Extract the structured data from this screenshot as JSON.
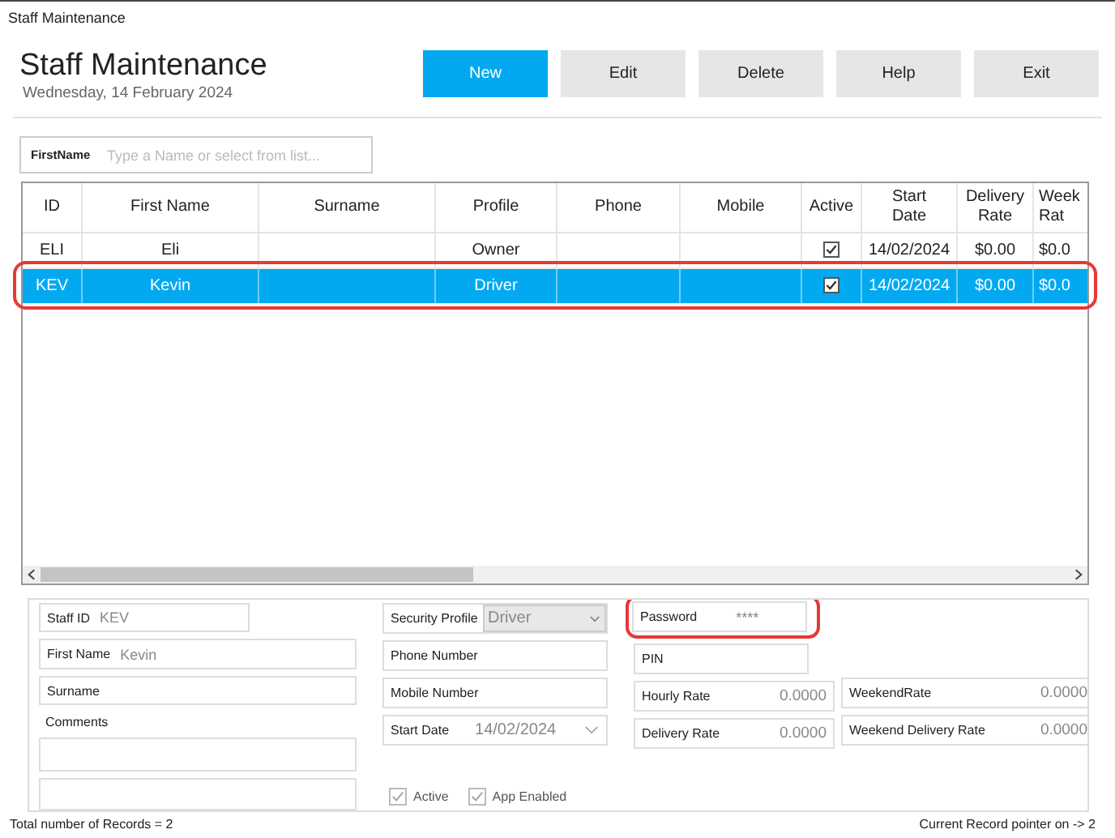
{
  "window": {
    "title": "Staff Maintenance"
  },
  "header": {
    "title": "Staff Maintenance",
    "date": "Wednesday, 14 February 2024"
  },
  "buttons": [
    {
      "label": "New",
      "primary": true
    },
    {
      "label": "Edit",
      "primary": false
    },
    {
      "label": "Delete",
      "primary": false
    },
    {
      "label": "Help",
      "primary": false
    },
    {
      "label": "Exit",
      "primary": false
    }
  ],
  "search": {
    "label": "FirstName",
    "placeholder": "Type a Name or select from list..."
  },
  "table": {
    "columns": [
      "ID",
      "First Name",
      "Surname",
      "Profile",
      "Phone",
      "Mobile",
      "Active",
      "Start Date",
      "Delivery Rate",
      "Week Rat"
    ],
    "rows": [
      {
        "id": "ELI",
        "first_name": "Eli",
        "profile": "Owner",
        "active": true,
        "start_date": "14/02/2024",
        "delivery_rate": "$0.00",
        "column_10": "$0.0",
        "selected": false,
        "highlighted": false
      },
      {
        "id": "KEV",
        "first_name": "Kevin",
        "profile": "Driver",
        "active": true,
        "start_date": "14/02/2024",
        "delivery_rate": "$0.00",
        "column_10": "$0.0",
        "selected": true,
        "highlighted": true
      }
    ]
  },
  "form": {
    "columns": [
      {
        "items": [
          {
            "kind": "text",
            "label": "Staff ID",
            "value": "KEV"
          },
          {
            "kind": "text",
            "label": "First Name",
            "value": "Kevin"
          },
          {
            "kind": "text",
            "label": "Surname"
          },
          {
            "kind": "caption",
            "label": "Comments"
          },
          {
            "kind": "memo"
          },
          {
            "kind": "memo"
          }
        ]
      },
      {
        "items": [
          {
            "kind": "combo",
            "label": "Security Profile",
            "value": "Driver",
            "disabled": true
          },
          {
            "kind": "text",
            "label": "Phone Number"
          },
          {
            "kind": "text",
            "label": "Mobile Number"
          },
          {
            "kind": "date",
            "label": "Start Date",
            "value": "14/02/2024"
          },
          {
            "kind": "checks",
            "checks": [
              {
                "label": "Active",
                "checked": true,
                "disabled": true
              },
              {
                "label": "App Enabled",
                "checked": true,
                "disabled": true
              }
            ]
          }
        ]
      },
      {
        "items": [
          {
            "kind": "password",
            "label": "Password",
            "value": "****",
            "highlighted": true
          },
          {
            "kind": "text",
            "label": "PIN"
          },
          {
            "kind": "number",
            "label": "Hourly Rate",
            "value": "0.0000"
          },
          {
            "kind": "number",
            "label": "Delivery Rate",
            "value": "0.0000"
          }
        ]
      },
      {
        "items": [
          {
            "kind": "number",
            "label": "WeekendRate",
            "value": "0.0000"
          },
          {
            "kind": "number",
            "label": "Weekend Delivery Rate",
            "value": "0.0000"
          }
        ]
      }
    ]
  },
  "status_bar": {
    "left": "Total number of Records = 2",
    "right": "Current Record pointer on -> 2"
  }
}
